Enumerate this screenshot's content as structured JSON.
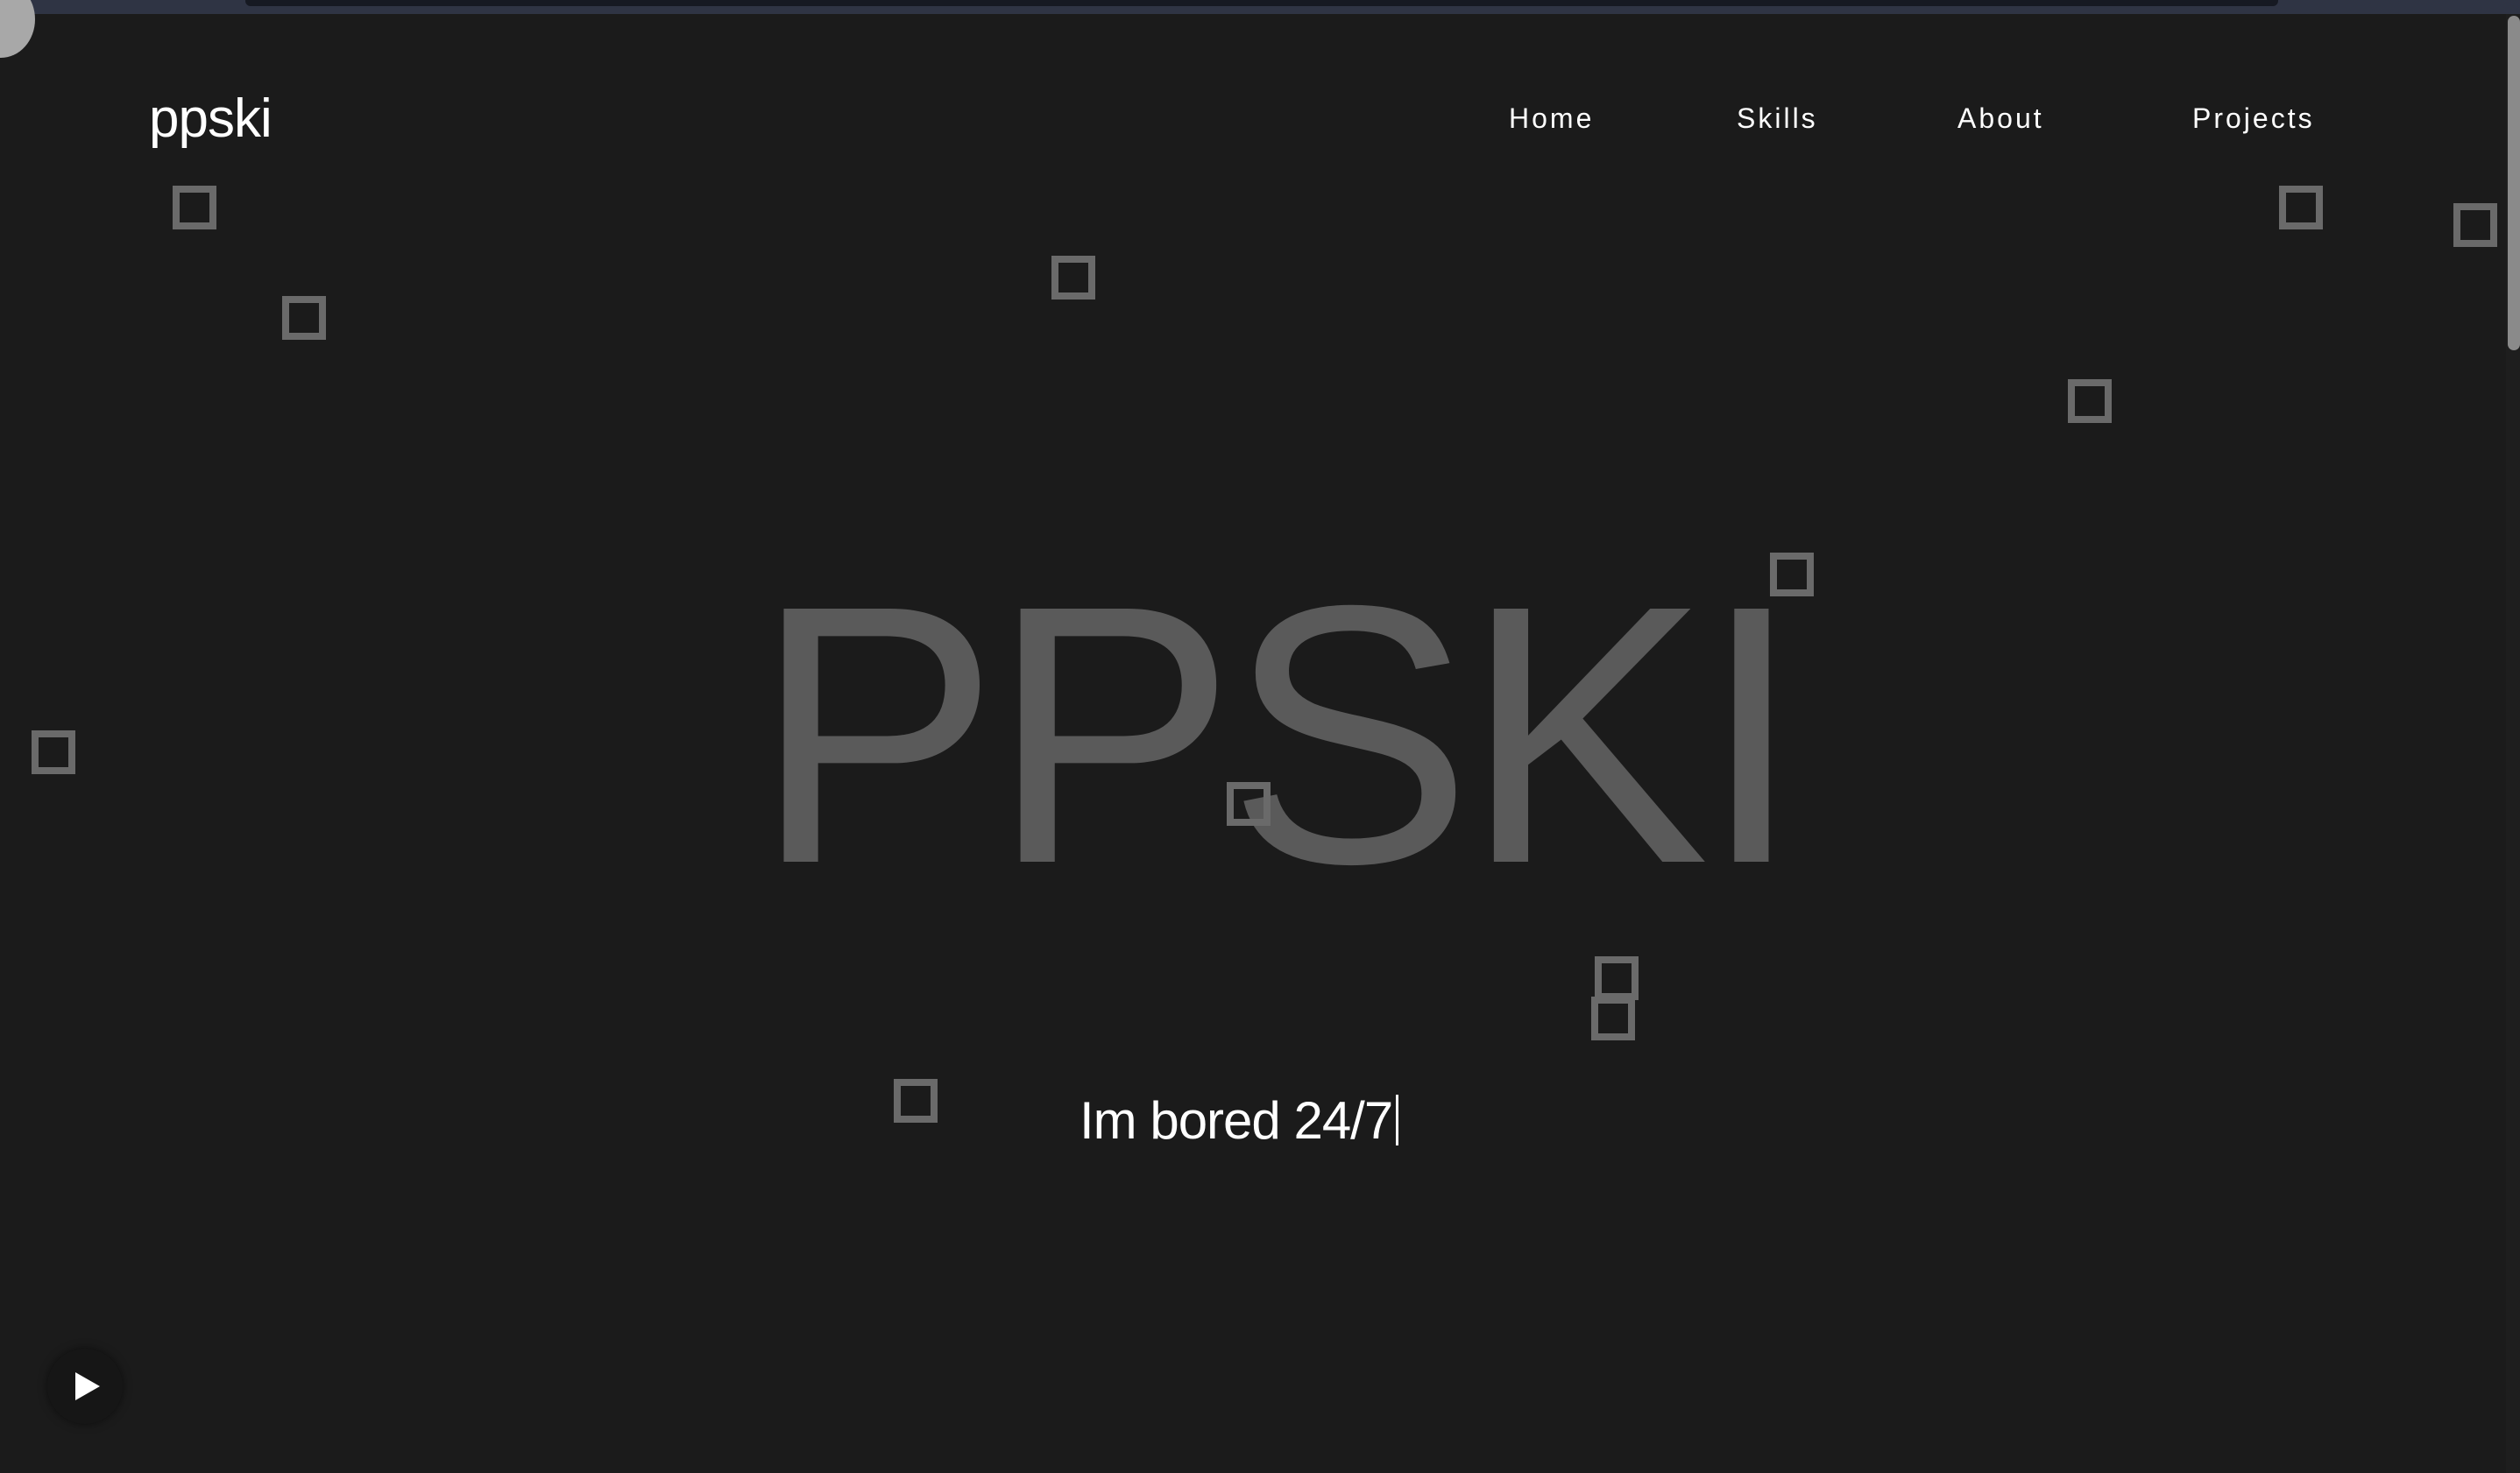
{
  "header": {
    "logo": "ppski",
    "nav": {
      "home": "Home",
      "skills": "Skills",
      "about": "About",
      "projects": "Projects"
    }
  },
  "hero": {
    "title": "PPSKI",
    "subtitle": "Im bored 24/7"
  },
  "player": {
    "icon": "play-icon"
  },
  "colors": {
    "background": "#1b1b1b",
    "title": "#5a5a5a",
    "text": "#ffffff",
    "square": "#6a6a6a"
  }
}
